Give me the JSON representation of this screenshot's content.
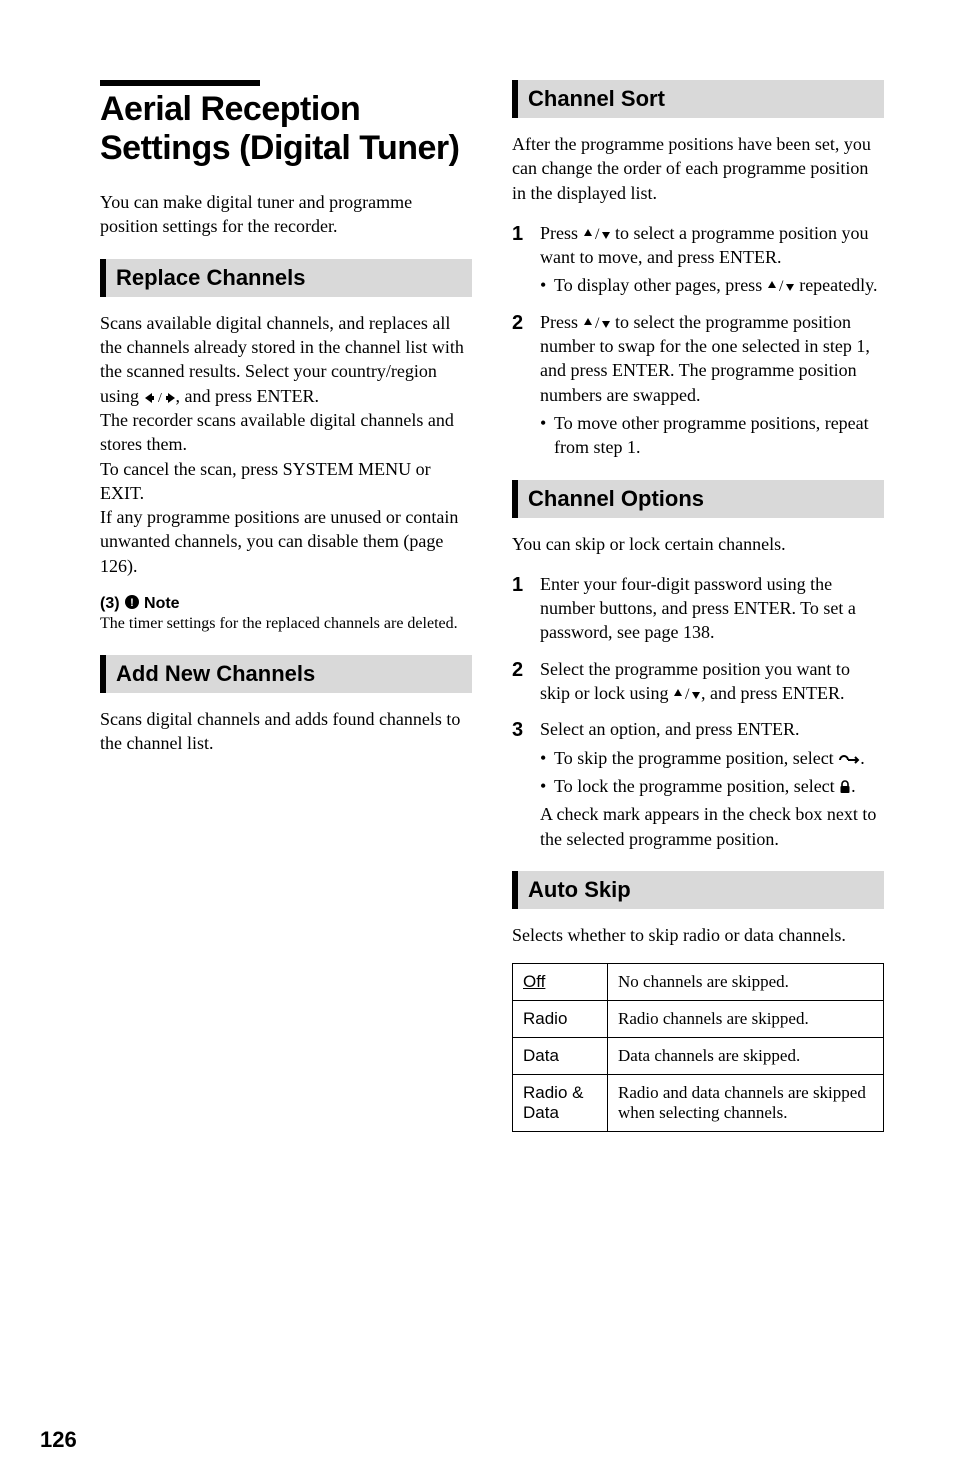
{
  "title": "Aerial Reception Settings (Digital Tuner)",
  "intro": "You can make digital tuner and programme position settings for the recorder.",
  "sections": {
    "replace": {
      "heading": "Replace Channels",
      "p1": "Scans available digital channels, and replaces all the channels already stored in the channel list with the scanned results.",
      "p2a": "Select your country/region using ",
      "p2b": ", and press ENTER.",
      "p3": "The recorder scans available digital channels and stores them.",
      "p4": "To cancel the scan, press SYSTEM MENU or EXIT.",
      "p5": "If any programme positions are unused or contain unwanted channels, you can disable them (page 126)."
    },
    "note": {
      "heading": "Note",
      "text": "The timer settings for the replaced channels are deleted."
    },
    "add": {
      "heading": "Add New Channels",
      "text": "Scans digital channels and adds found channels to the channel list."
    },
    "sort": {
      "heading": "Channel Sort",
      "intro": "After the programme positions have been set, you can change the order of each programme position in the displayed list.",
      "step1a": "Press ",
      "step1b": " to select a programme position you want to move, and press ENTER.",
      "step1_sub_a": "To display other pages, press ",
      "step1_sub_b": " repeatedly.",
      "step2a": "Press ",
      "step2b": " to select the programme position number to swap for the one selected in step 1, and press ENTER. The programme position numbers are swapped.",
      "step2_sub": "To move other programme positions, repeat from step 1."
    },
    "options": {
      "heading": "Channel Options",
      "intro": "You can skip or lock certain channels.",
      "step1": "Enter your four-digit password using the number buttons, and press ENTER. To set a password, see page 138.",
      "step2a": "Select the programme position you want to skip or lock using ",
      "step2b": ", and press ENTER.",
      "step3": "Select an option, and press ENTER.",
      "step3_sub1a": "To skip the programme position, select ",
      "step3_sub1b": ".",
      "step3_sub2a": "To lock the programme position, select ",
      "step3_sub2b": ".",
      "step3_tail": "A check mark appears in the check box next to the selected programme position."
    },
    "autoskip": {
      "heading": "Auto Skip",
      "intro": "Selects whether to skip radio or data channels.",
      "rows": [
        {
          "k": "Off",
          "v": "No channels are skipped.",
          "u": true
        },
        {
          "k": "Radio",
          "v": "Radio channels are skipped."
        },
        {
          "k": "Data",
          "v": "Data channels are skipped."
        },
        {
          "k": "Radio & Data",
          "v": "Radio and data channels are skipped when selecting channels."
        }
      ]
    }
  },
  "page": "126"
}
